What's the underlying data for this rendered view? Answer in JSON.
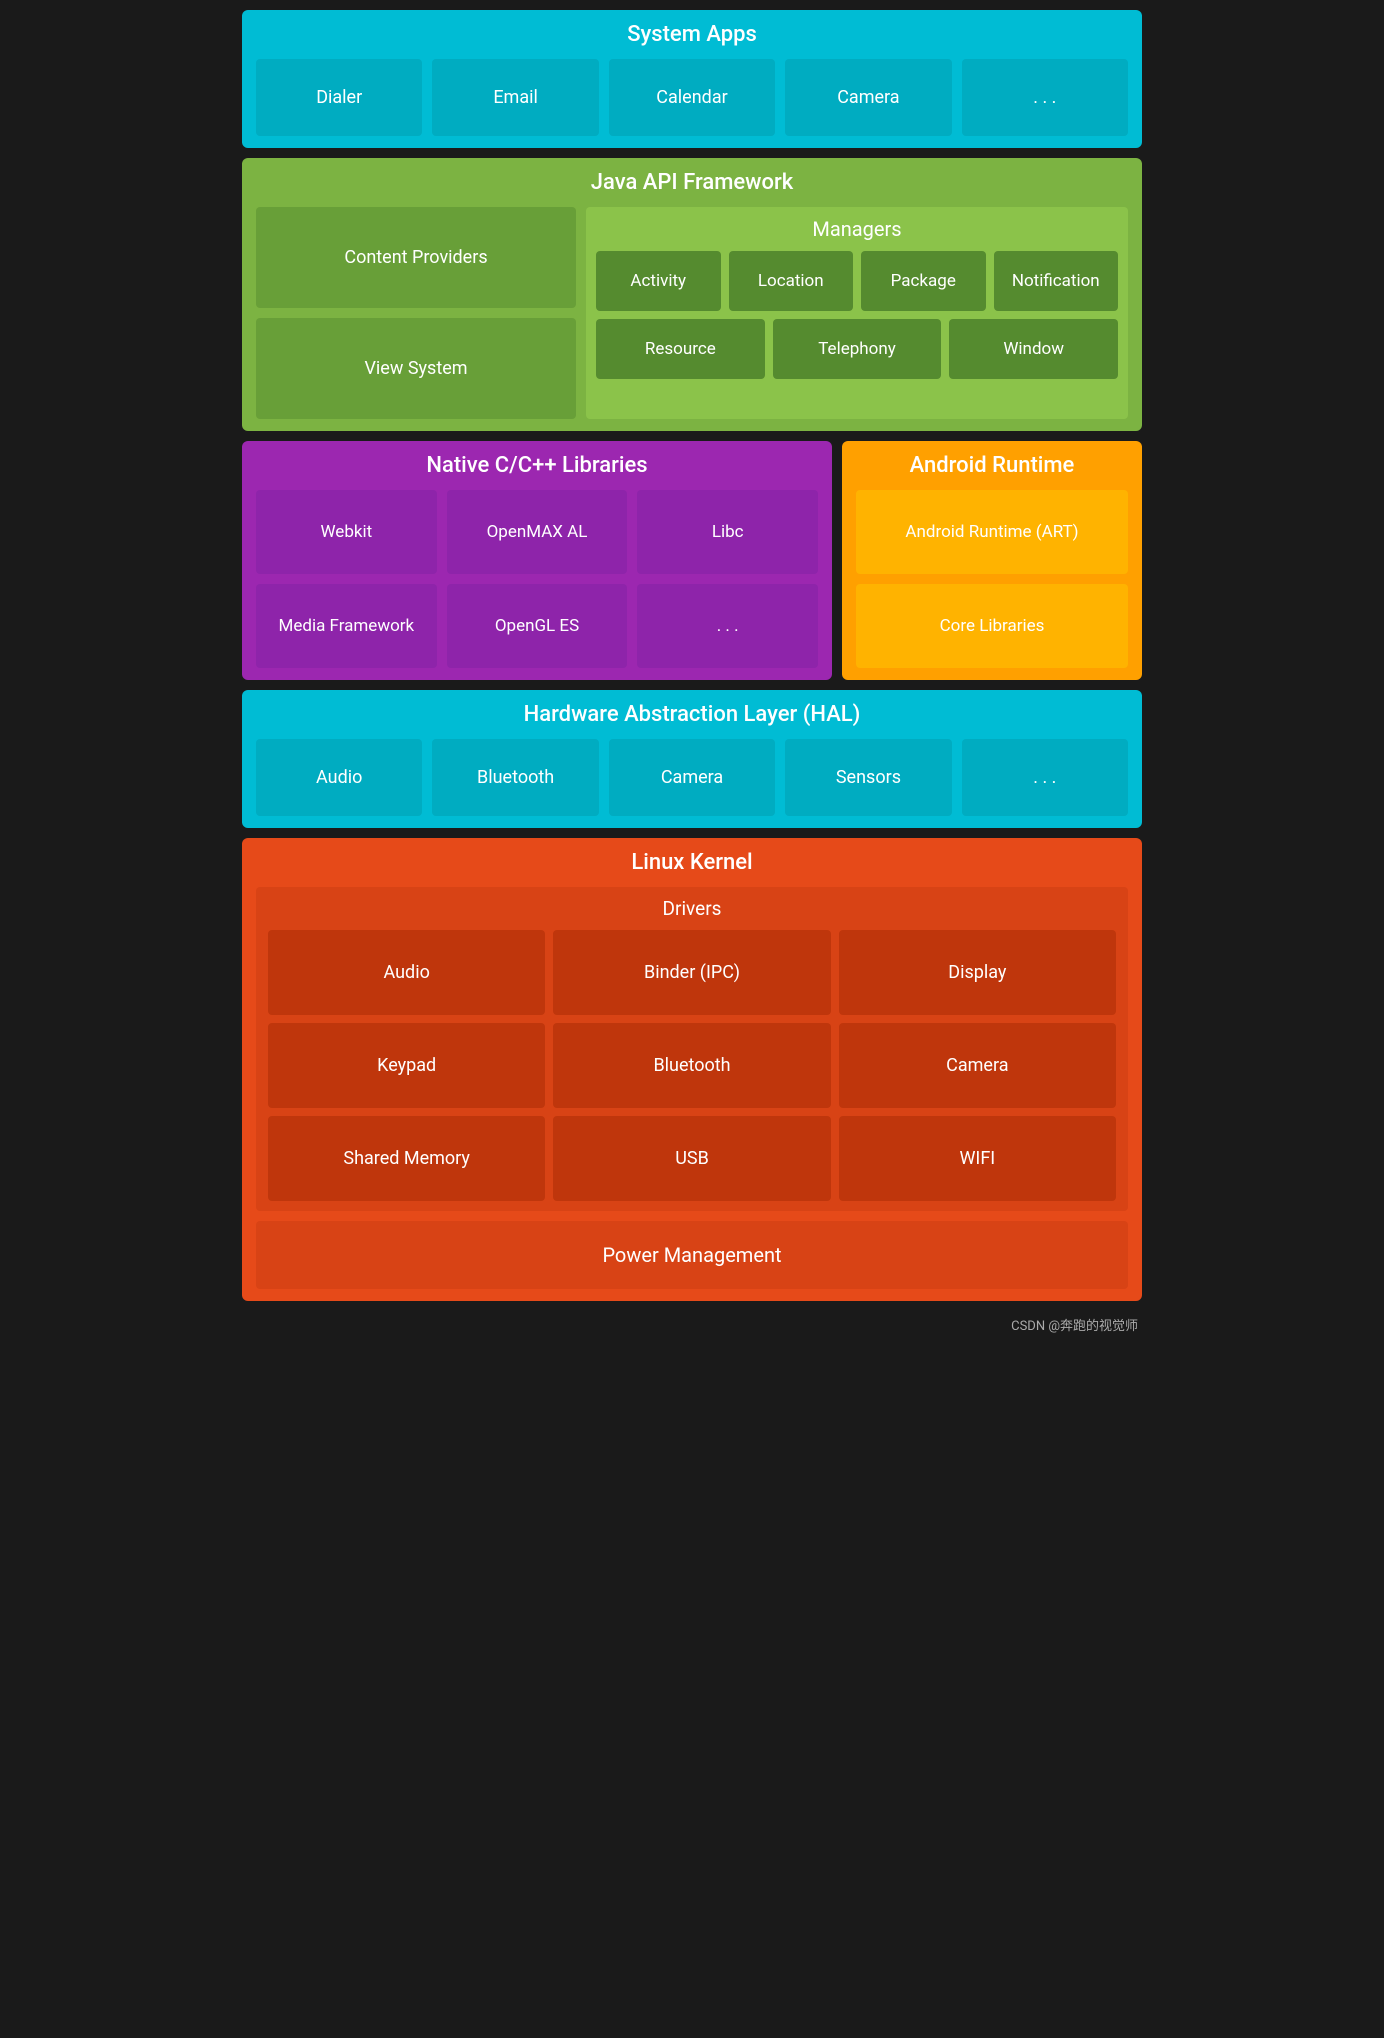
{
  "system_apps": {
    "title": "System Apps",
    "items": [
      "Dialer",
      "Email",
      "Calendar",
      "Camera",
      ". . ."
    ]
  },
  "java_api": {
    "title": "Java API Framework",
    "left_items": [
      "Content Providers",
      "View System"
    ],
    "managers_title": "Managers",
    "managers_row1": [
      "Activity",
      "Location",
      "Package",
      "Notification"
    ],
    "managers_row2": [
      "Resource",
      "Telephony",
      "Window"
    ]
  },
  "native_cpp": {
    "title": "Native C/C++ Libraries",
    "row1": [
      "Webkit",
      "OpenMAX AL",
      "Libc"
    ],
    "row2": [
      "Media Framework",
      "OpenGL ES",
      ". . ."
    ]
  },
  "android_runtime": {
    "title": "Android Runtime",
    "items": [
      "Android Runtime (ART)",
      "Core Libraries"
    ]
  },
  "hal": {
    "title": "Hardware Abstraction Layer (HAL)",
    "items": [
      "Audio",
      "Bluetooth",
      "Camera",
      "Sensors",
      ". . ."
    ]
  },
  "linux_kernel": {
    "title": "Linux Kernel",
    "drivers_title": "Drivers",
    "drivers_row1": [
      "Audio",
      "Binder (IPC)",
      "Display"
    ],
    "drivers_row2": [
      "Keypad",
      "Bluetooth",
      "Camera"
    ],
    "drivers_row3": [
      "Shared Memory",
      "USB",
      "WIFI"
    ],
    "power_management": "Power Management"
  },
  "watermark": "CSDN @奔跑的视觉师"
}
